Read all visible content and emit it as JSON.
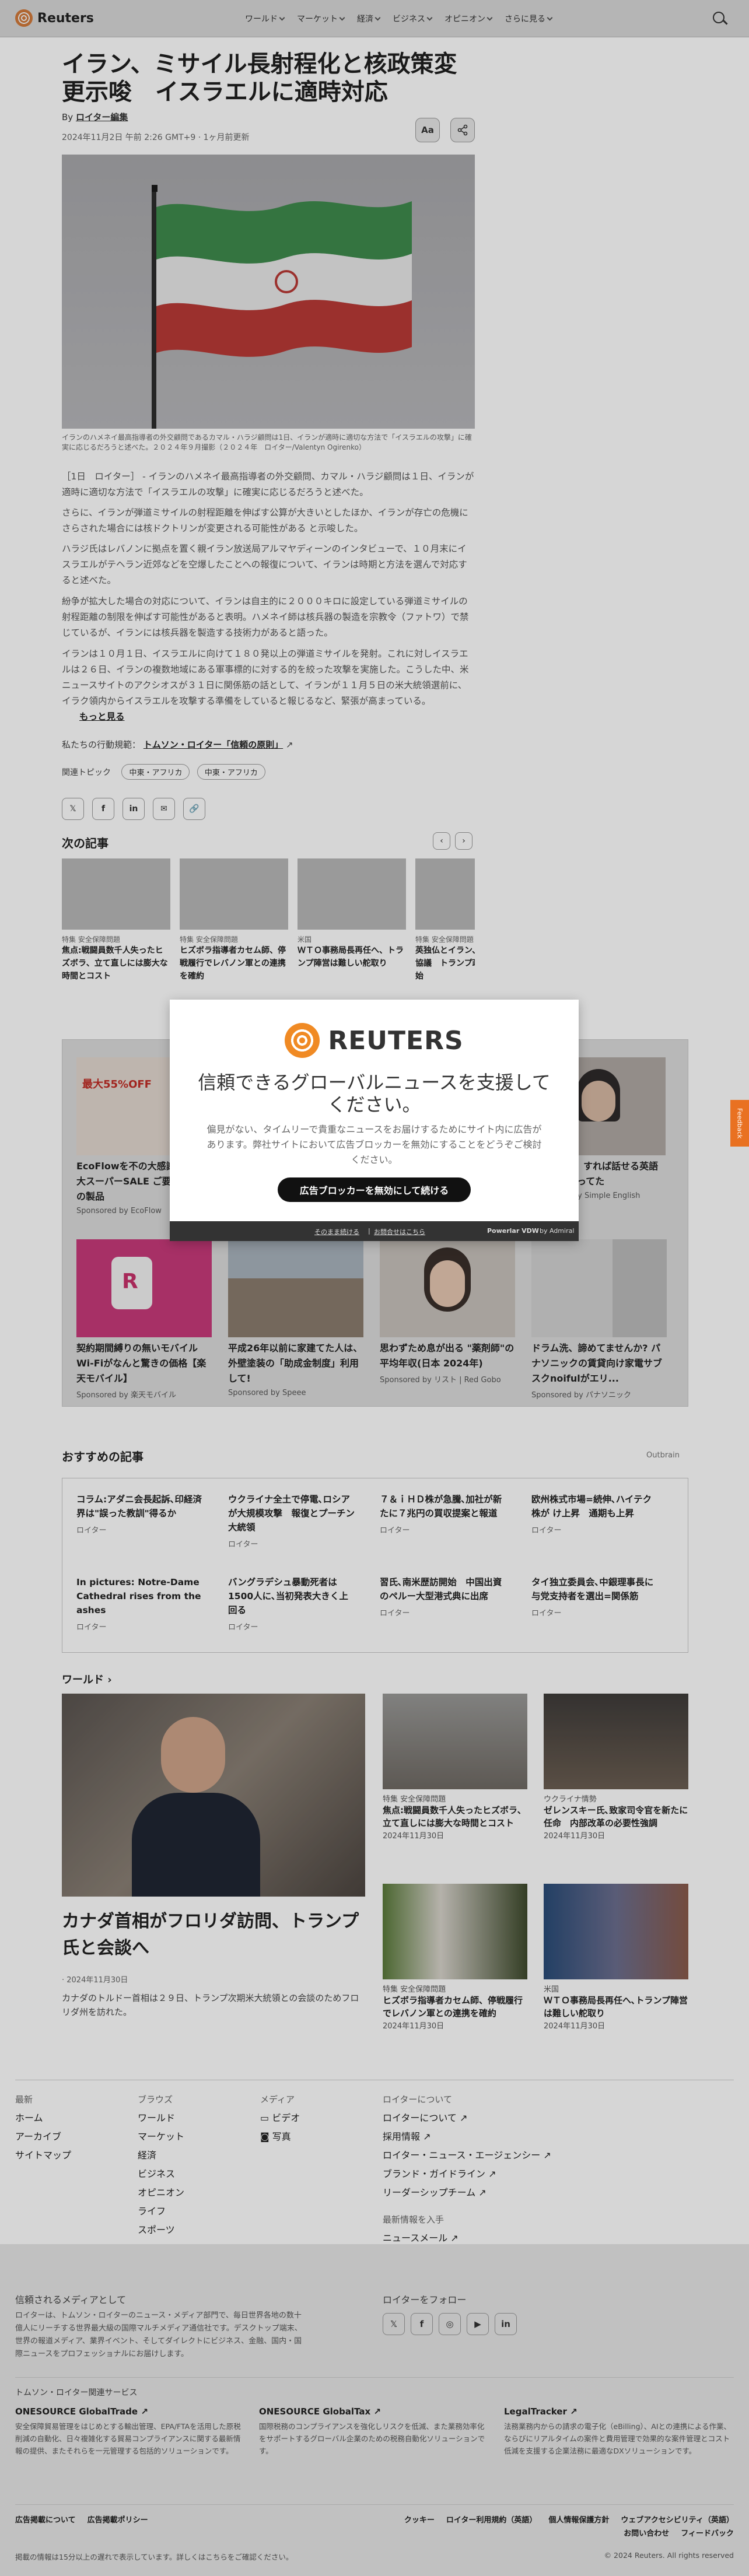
{
  "header": {
    "logo": "Reuters",
    "nav": [
      "ワールド",
      "マーケット",
      "経済",
      "ビジネス",
      "オピニオン",
      "さらに見る"
    ]
  },
  "article": {
    "title": "イラン、ミサイル長射程化と核政策変更示唆　イスラエルに適時対応",
    "byline_prefix": "By",
    "byline_author": "ロイター編集",
    "date": "2024年11月2日 午前 2:26 GMT+9 · 1ヶ月前更新",
    "font_button": "Aa",
    "caption": "イランのハメネイ最高指導者の外交顧問であるカマル・ハラジ顧問は1日、イランが適時に適切な方法で「イスラエルの攻撃」に確実に応じるだろうと述べた。２０２４年９月撮影（２０２４年　ロイター/Valentyn Ogirenko）",
    "paragraphs": [
      "［1日　ロイター］ - イランのハメネイ最高指導者の外交顧問、カマル・ハラジ顧問は１日、イランが適時に適切な方法で「イスラエルの攻撃」に確実に応じるだろうと述べた。",
      "さらに、イランが弾道ミサイルの射程距離を伸ばす公算が大きいとしたほか、イランが存亡の危機にさらされた場合には核ドクトリンが変更される可能性がある と示唆した。",
      "ハラジ氏はレバノンに拠点を置く親イラン放送局アルマヤディーンのインタビューで、１０月末にイスラエルがテヘラン近郊などを空爆したことへの報復について、イランは時期と方法を選んで対応すると述べた。",
      "紛争が拡大した場合の対応について、イランは自主的に２０００キロに設定している弾道ミサイルの射程距離の制限を伸ばす可能性があると表明。ハメネイ師は核兵器の製造を宗教令（ファトワ）で禁じているが、イランには核兵器を製造する技術力があると語った。",
      "イランは１０月１日、イスラエルに向けて１８０発以上の弾道ミサイルを発射。これに対しイスラエルは２６日、イランの複数地域にある軍事標的に対する的を絞った攻撃を実施した。こうした中、米ニュースサイトのアクシオスが３１日に関係筋の話として、イランが１１月５日の米大統領選前に、イラク領内からイスラエルを攻撃する準備をしていると報じるなど、緊張が高まっている。"
    ],
    "read_more": "もっと見る",
    "standards_prefix": "私たちの行動規範：",
    "standards_link": "トムソン・ロイター「信頼の原則」",
    "topics_label": "関連トピック",
    "topics": [
      "中東・アフリカ",
      "中東・アフリカ"
    ]
  },
  "next": {
    "heading": "次の記事",
    "cards": [
      {
        "cat": "特集 安全保障問題",
        "hl": "焦点:戦闘員数千人失ったヒズボラ、立て直しには膨大な時間とコスト"
      },
      {
        "cat": "特集 安全保障問題",
        "hl": "ヒズボラ指導者カセム師、停戦履行でレバノン軍との連携を確約"
      },
      {
        "cat": "米国",
        "hl": "ＷＴＯ事務局長再任へ、トランプ陣営は難しい舵取り"
      },
      {
        "cat": "特集 安全保障問題",
        "hl": "英独仏とイラン、核問題巡り協議　トランプ政権の打開開始"
      }
    ]
  },
  "ads": [
    {
      "hl": "EcoFlowを不の大感謝祭！最大スーパーSALE ご要望で最高の製品",
      "sp": "Sponsored by EcoFlow",
      "badge": "最大55%OFF"
    },
    {
      "hl": "",
      "sp": ""
    },
    {
      "hl": "",
      "sp": ""
    },
    {
      "hl": "【1文概記】すれば話せる英語通訳者がやってた",
      "sp": "Sponsored by Simple English"
    },
    {
      "hl": "契約期間縛りの無いモバイルWi-Fiがなんと驚きの価格【楽天モバイル】",
      "sp": "Sponsored by 楽天モバイル"
    },
    {
      "hl": "平成26年以前に家建てた人は、外壁塗装の「助成金制度」利用して!",
      "sp": "Sponsored by Speee"
    },
    {
      "hl": "思わずため息が出る \"薬剤師\"の平均年収(日本 2024年)",
      "sp": "Sponsored by リスト | Red Gobo"
    },
    {
      "hl": "ドラム洗、諦めてませんか? パナソニックの賃貸向け家電サブスクnoifulがエリ...",
      "sp": "Sponsored by パナソニック"
    }
  ],
  "recommended": {
    "heading": "おすすめの記事",
    "brand": "Outbrain",
    "items": [
      {
        "hl": "コラム:アダニ会長起訴､印経済界は\"誤った教訓\"得るか",
        "src": "ロイター"
      },
      {
        "hl": "ウクライナ全土で停電､ロシアが大規模攻撃　報復とプーチン大統領",
        "src": "ロイター"
      },
      {
        "hl": "７＆ｉＨＤ株が急騰､加社が新たに７兆円の買収提案と報道",
        "src": "ロイター"
      },
      {
        "hl": "欧州株式市場=続伸､ハイテク株が け上昇　通期も上昇",
        "src": "ロイター"
      },
      {
        "hl": "In pictures: Notre-Dame Cathedral rises from the ashes",
        "src": "ロイター"
      },
      {
        "hl": "バングラデシュ暴動死者は1500人に､当初発表大きく上回る",
        "src": "ロイター"
      },
      {
        "hl": "習氏､南米歴訪開始　中国出資のペルー大型港式典に出席",
        "src": "ロイター"
      },
      {
        "hl": "タイ独立委員会､中銀理事長に与党支持者を選出=関係筋",
        "src": "ロイター"
      }
    ]
  },
  "world": {
    "heading": "ワールド",
    "main": {
      "hl": "カナダ首相がフロリダ訪問、トランプ氏と会談へ",
      "date": "· 2024年11月30日",
      "desc": "カナダのトルドー首相は２９日、トランプ次期米大統領との会談のためフロリダ州を訪れた。"
    },
    "cards": [
      {
        "cat": "特集 安全保障問題",
        "hl": "焦点:戦闘員数千人失ったヒズボラ、立て直しには膨大な時間とコスト",
        "dt": "2024年11月30日"
      },
      {
        "cat": "ウクライナ情勢",
        "hl": "ゼレンスキー氏､致家司令官を新たに任命　内部改革の必要性強調",
        "dt": "2024年11月30日"
      },
      {
        "cat": "特集 安全保障問題",
        "hl": "ヒズボラ指導者カセム師、停戦履行でレバノン軍との連携を確約",
        "dt": "2024年11月30日"
      },
      {
        "cat": "米国",
        "hl": "ＷＴＯ事務局長再任へ､トランプ陣営は難しい舵取り",
        "dt": "2024年11月30日"
      }
    ]
  },
  "footer": {
    "col1": {
      "title": "最新",
      "items": [
        "ホーム",
        "アーカイブ",
        "サイトマップ"
      ]
    },
    "col2": {
      "title": "ブラウズ",
      "items": [
        "ワールド",
        "マーケット",
        "経済",
        "ビジネス",
        "オピニオン",
        "ライフ",
        "スポーツ"
      ]
    },
    "col3": {
      "title": "メディア",
      "items": [
        "ビデオ",
        "写真"
      ]
    },
    "col4": {
      "title": "ロイターについて",
      "items": [
        "ロイターについて",
        "採用情報",
        "ロイター・ニュース・エージェンシー",
        "ブランド・ガイドライン",
        "リーダーシップチーム"
      ]
    },
    "latest_title": "最新情報を入手",
    "newsletter": "ニュースメール",
    "trusted_title": "信頼されるメディアとして",
    "trusted_text": "ロイターは、トムソン・ロイターのニュース・メディア部門で、毎日世界各地の数十億人にリーチする世界最大級の国際マルチメディア通信社です。デスクトップ端末、世界の報道メディア、業界イベント、そしてダイレクトにビジネス、金融、国内・国際ニュースをプロフェッショナルにお届けします。",
    "follow_title": "ロイターをフォロー",
    "tr_services_title": "トムソン・ロイター関連サービス",
    "services": [
      {
        "name": "ONESOURCE GlobalTrade",
        "desc": "安全保障貿易管理をはじめとする輸出管理、EPA/FTAを活用した原税削減の自動化、日々複雑化する貿易コンプライアンスに関する最新情報の提供、またそれらを一元管理する包括的ソリューションです。"
      },
      {
        "name": "ONESOURCE GlobalTax",
        "desc": "国際税務のコンプライアンスを強化しリスクを低減、また業務効率化をサポートするグローバル企業のための税務自動化ソリューションです。"
      },
      {
        "name": "LegalTracker",
        "desc": "法務業務内からの請求の電子化（eBilling）、AIとの連携による作業、ならびにリアルタイムの案件と費用管理で効果的な案件管理とコスト低減を支援する企業法務に最適なDXソリューションです。"
      }
    ],
    "legal_links": [
      "広告掲載について",
      "広告掲載ポリシー",
      "クッキー",
      "ロイター利用規約（英語）",
      "個人情報保護方針",
      "ウェブアクセシビリティ（英語）",
      "お問い合わせ",
      "フィードバック"
    ],
    "delay_note": "掲載の情報は15分以上の遅れで表示しています。詳しくはこちらをご確認ください。",
    "copyright": "© 2024 Reuters. All rights reserved"
  },
  "modal": {
    "brand": "REUTERS",
    "title": "信頼できるグローバルニュースを支援してください。",
    "desc": "偏見がない、タイムリーで貴重なニュースをお届けするためにサイト内に広告があります。弊社サイトにおいて広告ブロッカーを無効にすることをどうぞご検討ください。",
    "button": "広告ブロッカーを無効にして続ける",
    "link_continue": "そのまま続ける",
    "link_help": "お問合せはこちら",
    "powered": "Powerlar VDW",
    "by": "by Admiral"
  },
  "feedback": "Feedback"
}
